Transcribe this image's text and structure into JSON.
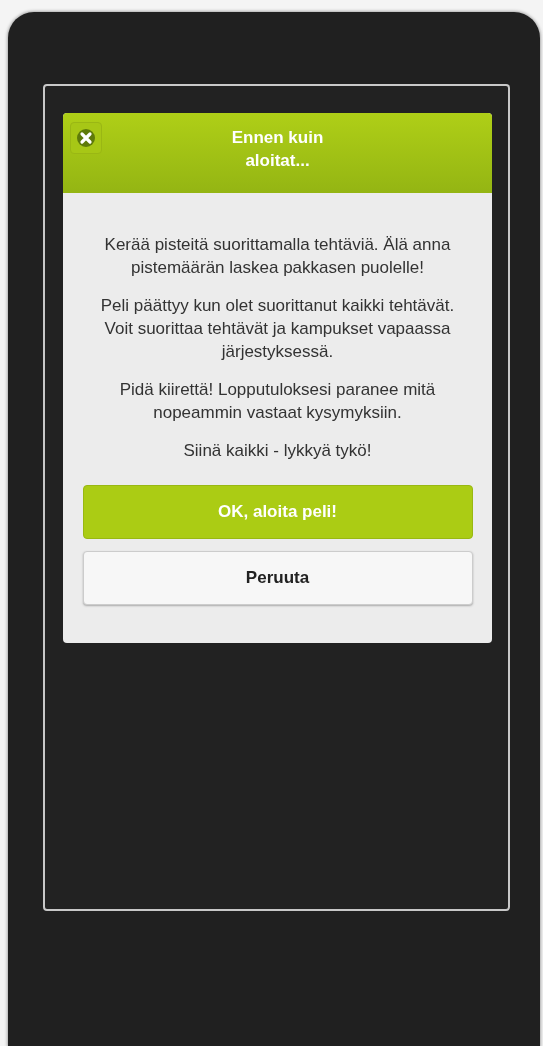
{
  "dialog": {
    "title": "Ennen kuin aloitat...",
    "paragraphs": [
      "Kerää pisteitä suorittamalla tehtäviä. Älä anna pistemäärän laskea pakkasen puolelle!",
      "Peli päättyy kun olet suorittanut kaikki tehtävät. Voit suorittaa tehtävät ja kampukset vapaassa järjestyksessä.",
      "Pidä kiirettä! Lopputuloksesi paranee mitä nopeammin vastaat kysymyksiin.",
      "Siinä kaikki - lykkyä tykö!"
    ],
    "buttons": [
      {
        "label": "OK, aloita peli!",
        "kind": "primary"
      },
      {
        "label": "Peruuta",
        "kind": "secondary"
      }
    ]
  }
}
